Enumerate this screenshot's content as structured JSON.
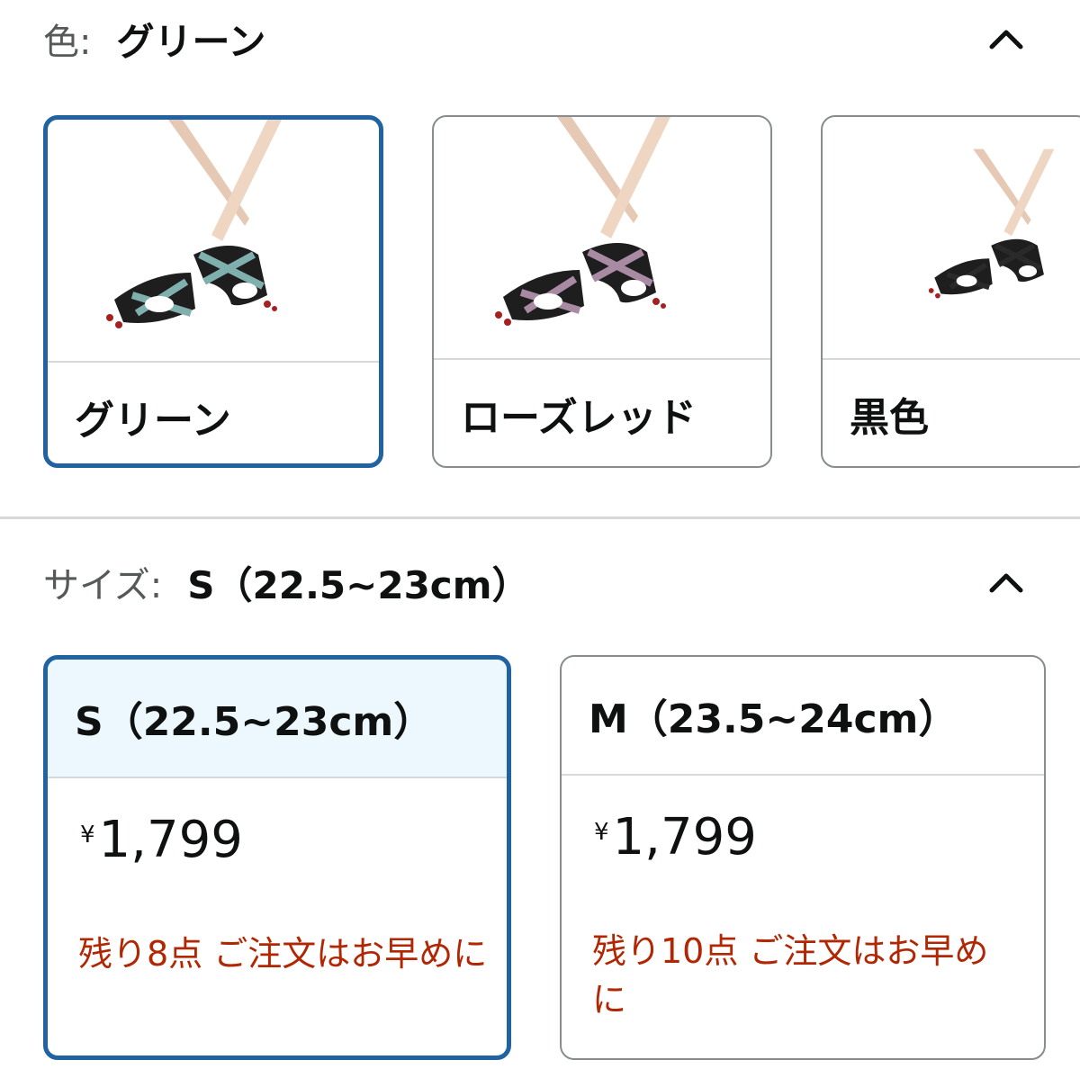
{
  "color_section": {
    "label": "色:",
    "value": "グリーン",
    "swatches": [
      {
        "label": "グリーン",
        "strap_color": "#7fb0ad",
        "selected": true
      },
      {
        "label": "ローズレッド",
        "strap_color": "#a98aa3",
        "selected": false
      },
      {
        "label": "黒色",
        "strap_color": "#2a2a2a",
        "selected": false
      }
    ]
  },
  "size_section": {
    "label": "サイズ:",
    "value": "S（22.5~23cm）",
    "options": [
      {
        "size": "S（22.5~23cm）",
        "currency": "¥",
        "price": "1,799",
        "stock": "残り8点 ご注文はお早めに",
        "selected": true
      },
      {
        "size": "M（23.5~24cm）",
        "currency": "¥",
        "price": "1,799",
        "stock": "残り10点 ご注文はお早めに",
        "selected": false
      }
    ]
  },
  "colors": {
    "accent": "#2162a1",
    "stock_text": "#b12704",
    "selected_bg": "#edf8fe"
  }
}
